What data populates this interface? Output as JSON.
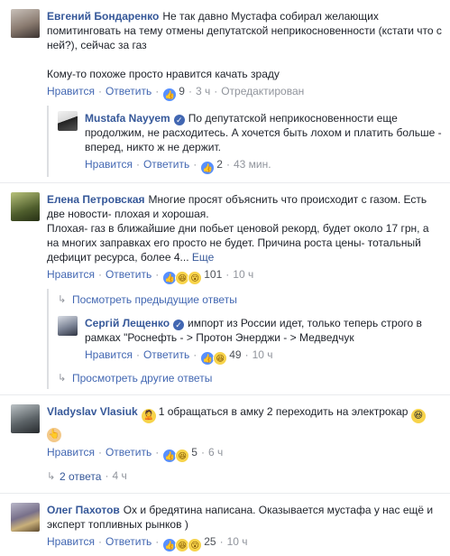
{
  "action_like": "Нравится",
  "action_reply": "Ответить",
  "comments": [
    {
      "author": "Евгений Бондаренко",
      "text": "Не так давно Мустафа собирал желающих помитинговать на тему отмены депутатской неприкосновенности (кстати что с ней?), сейчас за газ\n\nКому-то похоже просто нравится качать зраду",
      "reactions": "9",
      "time": "3 ч",
      "status": "Отредактирован"
    },
    {
      "author": "Mustafa Nayyem",
      "text": "По депутатской неприкосновенности еще продолжим, не расходитесь. А хочется быть лохом и платить больше - вперед, никто ж не держит.",
      "reactions": "2",
      "time": "43 мин."
    },
    {
      "author": "Елена Петровская",
      "text": "Многие просят объяснить что происходит с газом. Есть две новости- плохая и хорошая.\nПлохая- газ в ближайшие дни побьет ценовой рекорд, будет около 17 грн, а на многих заправках его просто не будет. Причина роста цены- тотальный дефицит ресурса, более 4...",
      "more": "Еще",
      "reactions": "101",
      "time": "10 ч",
      "prev_replies": "Посмотреть предыдущие ответы"
    },
    {
      "author": "Сергій Лещенко",
      "text": "импорт из России идет, только теперь строго в рамках \"Роснефть - > Протон Энерджи - > Медведчук",
      "reactions": "49",
      "time": "10 ч",
      "other_replies": "Просмотреть другие ответы"
    },
    {
      "author": "Vladyslav Vlasiuk",
      "text": "1 обращаться в амку 2 переходить на электрокар",
      "reactions": "5",
      "time": "6 ч",
      "replies_count": "2 ответа",
      "replies_time": "4 ч"
    },
    {
      "author": "Олег Пахотов",
      "text": "Ох и бредятина написана. Оказывается мустафа у нас ещё и эксперт топливных рынков )",
      "reactions": "25",
      "time": "10 ч"
    }
  ]
}
